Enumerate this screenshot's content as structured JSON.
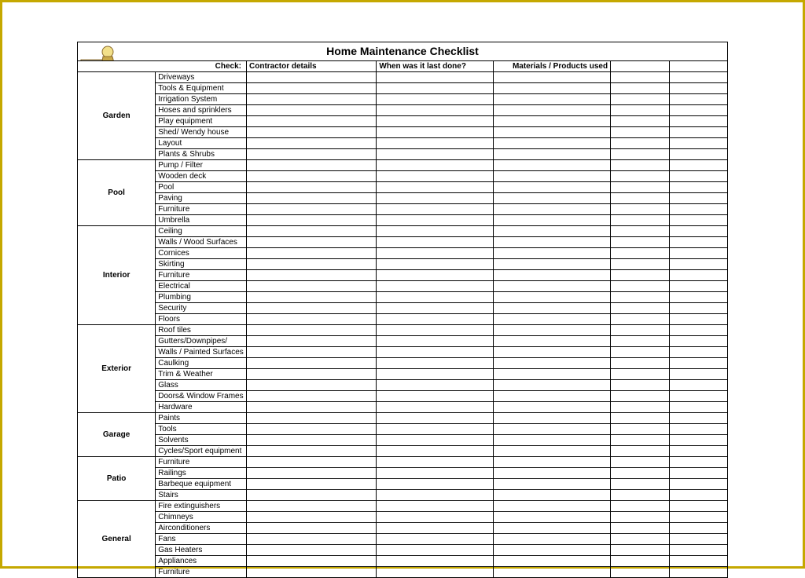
{
  "title": "Home Maintenance Checklist",
  "headers": {
    "check": "Check:",
    "contractor": "Contractor details",
    "last_done": "When was it last done?",
    "materials": "Materials / Products used"
  },
  "sections": [
    {
      "name": "Garden",
      "items": [
        "Driveways",
        "Tools & Equipment",
        "Irrigation System",
        "Hoses and sprinklers",
        "Play equipment",
        "Shed/ Wendy house",
        "Layout",
        "Plants & Shrubs"
      ]
    },
    {
      "name": "Pool",
      "items": [
        "Pump / Filter",
        "Wooden deck",
        "Pool",
        "Paving",
        "Furniture",
        "Umbrella"
      ]
    },
    {
      "name": "Interior",
      "items": [
        "Ceiling",
        "Walls / Wood Surfaces",
        "Cornices",
        "Skirting",
        "Furniture",
        "Electrical",
        "Plumbing",
        "Security",
        "Floors"
      ]
    },
    {
      "name": "Exterior",
      "items": [
        "Roof tiles",
        "Gutters/Downpipes/",
        "Walls / Painted Surfaces",
        "Caulking",
        "Trim & Weather",
        "Glass",
        "Doors& Window Frames",
        "Hardware"
      ]
    },
    {
      "name": "Garage",
      "items": [
        "Paints",
        "Tools",
        "Solvents",
        "Cycles/Sport equipment"
      ]
    },
    {
      "name": "Patio",
      "items": [
        "Furniture",
        "Railings",
        "Barbeque equipment",
        "Stairs"
      ]
    },
    {
      "name": "General",
      "items": [
        "Fire extinguishers",
        "Chimneys",
        "Airconditioners",
        "Fans",
        "Gas Heaters",
        "Appliances",
        "Furniture"
      ]
    }
  ]
}
